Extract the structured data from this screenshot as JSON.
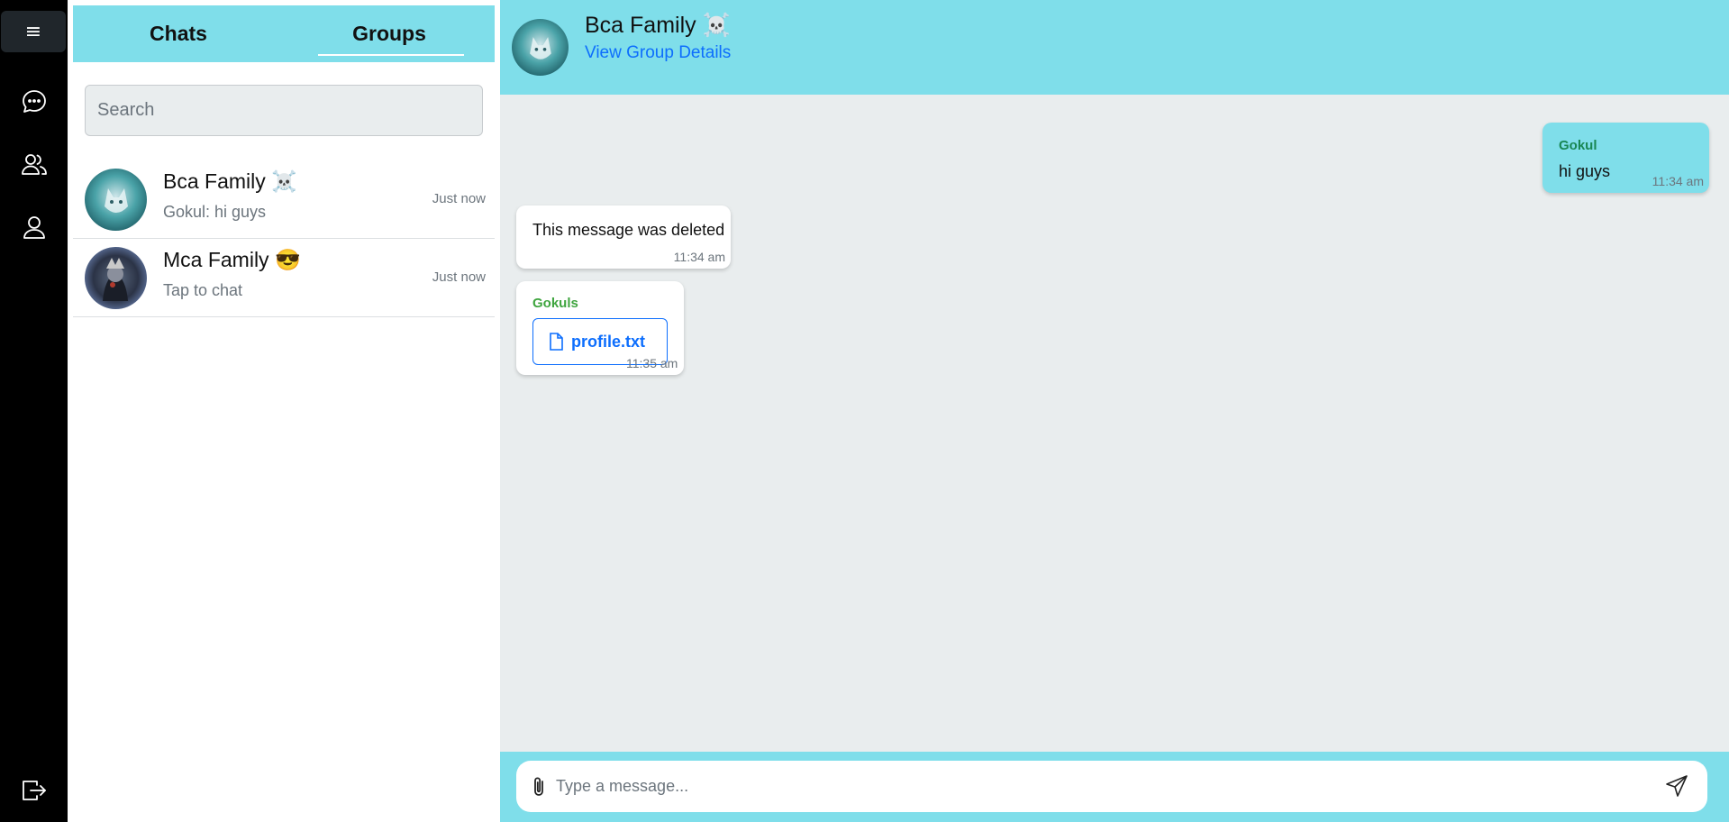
{
  "rail": {
    "menu_label": "≡",
    "icons": [
      "chat-icon",
      "groups-icon",
      "profile-icon",
      "logout-icon"
    ]
  },
  "tabs": [
    {
      "label": "Chats",
      "active": false
    },
    {
      "label": "Groups",
      "active": true
    }
  ],
  "search": {
    "placeholder": "Search"
  },
  "conversations": [
    {
      "name": "Bca Family ☠️",
      "subtitle": "Gokul: hi guys",
      "time": "Just now"
    },
    {
      "name": "Mca Family 😎",
      "subtitle": "Tap to chat",
      "time": "Just now"
    }
  ],
  "header": {
    "title": "Bca Family ☠️",
    "details_link": "View Group Details"
  },
  "messages": [
    {
      "sender": "Gokul",
      "text": "hi guys",
      "time": "11:34 am",
      "outgoing": true
    },
    {
      "sender": "",
      "text": "This message was deleted",
      "time": "11:34 am",
      "outgoing": false
    },
    {
      "sender": "Gokuls",
      "file": "profile.txt",
      "time": "11:35 am",
      "outgoing": false
    }
  ],
  "composer": {
    "placeholder": "Type a message..."
  },
  "colors": {
    "accent": "#7fdeea",
    "rail": "#000000",
    "chat_bg": "#e9edee",
    "link": "#0d6efd"
  }
}
